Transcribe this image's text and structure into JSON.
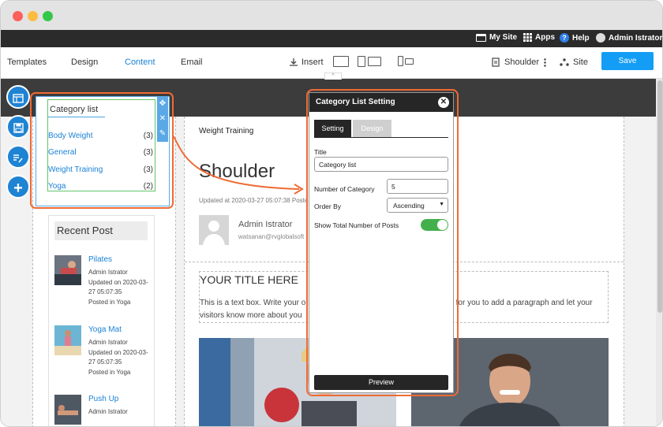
{
  "window": {
    "controls": [
      "close",
      "minimize",
      "maximize"
    ]
  },
  "topbar": {
    "my_site": "My Site",
    "apps": "Apps",
    "help": "Help",
    "help_glyph": "?",
    "user": "Admin Istrator"
  },
  "toolbar": {
    "tabs": [
      "Templates",
      "Design",
      "Content",
      "Email"
    ],
    "active_tab": "Content",
    "insert": "Insert",
    "page_selector": "Shoulder",
    "site": "Site",
    "save": "Save",
    "accent_color": "#149df5"
  },
  "sidebar": {
    "fab_icons": [
      "layout-icon",
      "save-icon",
      "edit-list-icon",
      "plus-icon"
    ],
    "category_widget": {
      "title": "Category list",
      "items": [
        {
          "label": "Body Weight",
          "count": "(3)"
        },
        {
          "label": "General",
          "count": "(3)"
        },
        {
          "label": "Weight Training",
          "count": "(3)"
        },
        {
          "label": "Yoga",
          "count": "(2)"
        }
      ]
    },
    "recent_post": {
      "title": "Recent Post",
      "posts": [
        {
          "title": "Pilates",
          "author": "Admin Istrator",
          "updated": "Updated on 2020-03-27 05:07:35",
          "posted_in": "Posted in Yoga"
        },
        {
          "title": "Yoga Mat",
          "author": "Admin Istrator",
          "updated": "Updated on 2020-03-27 05:07:35",
          "posted_in": "Posted in Yoga"
        },
        {
          "title": "Push Up",
          "author": "Admin Istrator",
          "updated": "",
          "posted_in": ""
        }
      ]
    }
  },
  "main": {
    "breadcrumb": "Weight Training",
    "title": "Shoulder",
    "updated": "Updated at 2020-03-27 05:07:38 Poste",
    "author": "Admin Istrator",
    "email": "watsanan@rvglobalsoft",
    "textbox_title": "YOUR TITLE HERE",
    "textbox_body_left": "This is a text box. Write your o",
    "textbox_body_right": "e for you to add a paragraph and let your",
    "textbox_body_line2": "visitors know more about you"
  },
  "dialog": {
    "title": "Category List Setting",
    "close_glyph": "✕",
    "tabs": [
      "Setting",
      "Design"
    ],
    "active_tab": "Setting",
    "fields": {
      "title_label": "Title",
      "title_value": "Category list",
      "number_label": "Number of Category",
      "number_value": "5",
      "order_label": "Order By",
      "order_value": "Ascending",
      "show_total_label": "Show Total Number of Posts",
      "show_total": true
    },
    "preview": "Preview"
  },
  "colors": {
    "highlight": "#ef6a35",
    "link": "#1b82d6",
    "toggle_on": "#44b04c"
  }
}
